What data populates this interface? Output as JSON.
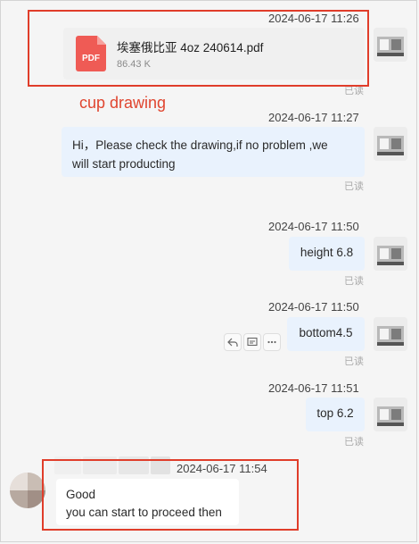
{
  "messages": {
    "m1": {
      "timestamp": "2024-06-17 11:26",
      "file_name": "埃塞俄比亚 4oz 240614.pdf",
      "file_size": "86.43 K",
      "file_type": "PDF",
      "read_status": "已读"
    },
    "m2": {
      "timestamp": "2024-06-17 11:27",
      "line1": "Hi，Please check the drawing,if no problem ,we",
      "line2": "will start producting",
      "read_status": "已读"
    },
    "m3": {
      "timestamp": "2024-06-17 11:50",
      "text": "height 6.8",
      "read_status": "已读"
    },
    "m4": {
      "timestamp": "2024-06-17 11:50",
      "text": "bottom4.5",
      "read_status": "已读"
    },
    "m5": {
      "timestamp": "2024-06-17 11:51",
      "text": "top 6.2",
      "read_status": "已读"
    },
    "m6": {
      "timestamp": "2024-06-17 11:54",
      "line1": "Good",
      "line2": "you can start to proceed then"
    }
  },
  "annotation": {
    "text": "cup drawing",
    "color": "#e0452f"
  },
  "actions": {
    "reply": "reply-icon",
    "quote": "quote-icon",
    "more": "more-icon"
  },
  "colors": {
    "bubble_self": "#e9f2fd",
    "bubble_other": "#ffffff",
    "highlight": "#e03d2a",
    "pdf_red": "#ef5b55"
  }
}
